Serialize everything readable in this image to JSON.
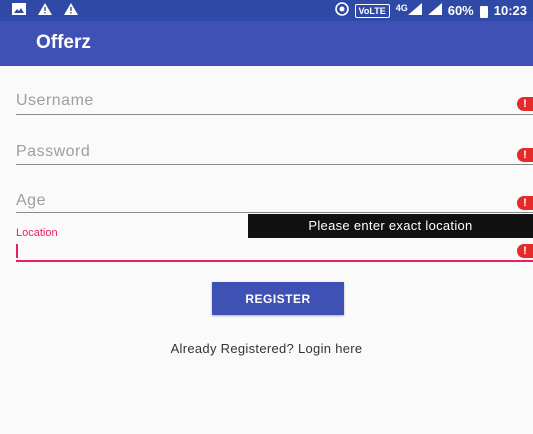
{
  "status_bar": {
    "left_icons": [
      "image-icon",
      "warning-icon",
      "warning-icon"
    ],
    "volte_label": "VoLTE",
    "network_label": "4G",
    "battery_percent": "60%",
    "time": "10:23"
  },
  "app_bar": {
    "title": "Offerz"
  },
  "form": {
    "username_placeholder": "Username",
    "password_placeholder": "Password",
    "age_placeholder": "Age",
    "location_label": "Location",
    "error_glyph": "!",
    "location_error_tooltip": "Please enter exact location",
    "register_label": "REGISTER",
    "login_link": "Already Registered? Login here"
  },
  "colors": {
    "primary": "#3f51b5",
    "primary_dark": "#2f4aa6",
    "accent": "#e91e63",
    "error": "#e52a2a"
  }
}
